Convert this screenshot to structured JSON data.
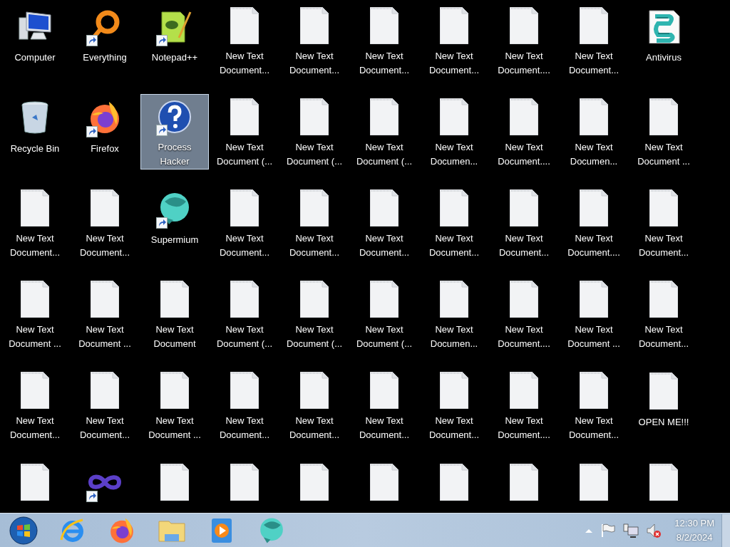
{
  "desktop": {
    "rows": [
      {
        "icons": [
          {
            "kind": "computer",
            "label": "Computer",
            "shortcut": false,
            "selected": false
          },
          {
            "kind": "search-ring",
            "label": "Everything",
            "shortcut": true,
            "selected": false
          },
          {
            "kind": "notepad",
            "label": "Notepad++",
            "shortcut": true,
            "selected": false
          },
          {
            "kind": "textfile",
            "label": "New Text Document...",
            "shortcut": false,
            "selected": false
          },
          {
            "kind": "textfile",
            "label": "New Text Document...",
            "shortcut": false,
            "selected": false
          },
          {
            "kind": "textfile",
            "label": "New Text Document...",
            "shortcut": false,
            "selected": false
          },
          {
            "kind": "textfile",
            "label": "New Text Document...",
            "shortcut": false,
            "selected": false
          },
          {
            "kind": "textfile",
            "label": "New Text Document....",
            "shortcut": false,
            "selected": false
          },
          {
            "kind": "textfile",
            "label": "New Text Document...",
            "shortcut": false,
            "selected": false
          },
          {
            "kind": "script",
            "label": "Antivirus",
            "shortcut": false,
            "selected": false
          }
        ]
      },
      {
        "icons": [
          {
            "kind": "recycle",
            "label": "Recycle Bin",
            "shortcut": false,
            "selected": false
          },
          {
            "kind": "firefox",
            "label": "Firefox",
            "shortcut": true,
            "selected": false
          },
          {
            "kind": "question",
            "label": "Process Hacker",
            "shortcut": true,
            "selected": true
          },
          {
            "kind": "textfile",
            "label": "New Text Document (...",
            "shortcut": false,
            "selected": false
          },
          {
            "kind": "textfile",
            "label": "New Text Document (...",
            "shortcut": false,
            "selected": false
          },
          {
            "kind": "textfile",
            "label": "New Text Document (...",
            "shortcut": false,
            "selected": false
          },
          {
            "kind": "textfile",
            "label": "New Text Documen...",
            "shortcut": false,
            "selected": false
          },
          {
            "kind": "textfile",
            "label": "New Text Document....",
            "shortcut": false,
            "selected": false
          },
          {
            "kind": "textfile",
            "label": "New Text Documen...",
            "shortcut": false,
            "selected": false
          },
          {
            "kind": "textfile",
            "label": "New Text Document ...",
            "shortcut": false,
            "selected": false
          }
        ]
      },
      {
        "icons": [
          {
            "kind": "textfile",
            "label": "New Text Document...",
            "shortcut": false,
            "selected": false
          },
          {
            "kind": "textfile",
            "label": "New Text Document...",
            "shortcut": false,
            "selected": false
          },
          {
            "kind": "sphere",
            "label": "Supermium",
            "shortcut": true,
            "selected": false
          },
          {
            "kind": "textfile",
            "label": "New Text Document...",
            "shortcut": false,
            "selected": false
          },
          {
            "kind": "textfile",
            "label": "New Text Document...",
            "shortcut": false,
            "selected": false
          },
          {
            "kind": "textfile",
            "label": "New Text Document...",
            "shortcut": false,
            "selected": false
          },
          {
            "kind": "textfile",
            "label": "New Text Document...",
            "shortcut": false,
            "selected": false
          },
          {
            "kind": "textfile",
            "label": "New Text Document...",
            "shortcut": false,
            "selected": false
          },
          {
            "kind": "textfile",
            "label": "New Text Document....",
            "shortcut": false,
            "selected": false
          },
          {
            "kind": "textfile",
            "label": "New Text Document...",
            "shortcut": false,
            "selected": false
          }
        ]
      },
      {
        "icons": [
          {
            "kind": "textfile",
            "label": "New Text Document ...",
            "shortcut": false,
            "selected": false
          },
          {
            "kind": "textfile",
            "label": "New Text Document ...",
            "shortcut": false,
            "selected": false
          },
          {
            "kind": "textfile",
            "label": "New Text Document",
            "shortcut": false,
            "selected": false
          },
          {
            "kind": "textfile",
            "label": "New Text Document (...",
            "shortcut": false,
            "selected": false
          },
          {
            "kind": "textfile",
            "label": "New Text Document (...",
            "shortcut": false,
            "selected": false
          },
          {
            "kind": "textfile",
            "label": "New Text Document (...",
            "shortcut": false,
            "selected": false
          },
          {
            "kind": "textfile",
            "label": "New Text Documen...",
            "shortcut": false,
            "selected": false
          },
          {
            "kind": "textfile",
            "label": "New Text Document....",
            "shortcut": false,
            "selected": false
          },
          {
            "kind": "textfile",
            "label": "New Text Document ...",
            "shortcut": false,
            "selected": false
          },
          {
            "kind": "textfile",
            "label": "New Text Document...",
            "shortcut": false,
            "selected": false
          }
        ]
      },
      {
        "icons": [
          {
            "kind": "textfile",
            "label": "New Text Document...",
            "shortcut": false,
            "selected": false
          },
          {
            "kind": "textfile",
            "label": "New Text Document...",
            "shortcut": false,
            "selected": false
          },
          {
            "kind": "textfile",
            "label": "New Text Document ...",
            "shortcut": false,
            "selected": false
          },
          {
            "kind": "textfile",
            "label": "New Text Document...",
            "shortcut": false,
            "selected": false
          },
          {
            "kind": "textfile",
            "label": "New Text Document...",
            "shortcut": false,
            "selected": false
          },
          {
            "kind": "textfile",
            "label": "New Text Document...",
            "shortcut": false,
            "selected": false
          },
          {
            "kind": "textfile",
            "label": "New Text Document...",
            "shortcut": false,
            "selected": false
          },
          {
            "kind": "textfile",
            "label": "New Text Document....",
            "shortcut": false,
            "selected": false
          },
          {
            "kind": "textfile",
            "label": "New Text Document...",
            "shortcut": false,
            "selected": false
          },
          {
            "kind": "textfile",
            "label": "OPEN ME!!!",
            "shortcut": false,
            "selected": false
          }
        ]
      },
      {
        "icons": [
          {
            "kind": "textfile",
            "shortcut": false,
            "selected": false
          },
          {
            "kind": "infinity",
            "shortcut": true,
            "selected": false
          },
          {
            "kind": "textfile",
            "shortcut": false,
            "selected": false
          },
          {
            "kind": "textfile",
            "shortcut": false,
            "selected": false
          },
          {
            "kind": "textfile",
            "shortcut": false,
            "selected": false
          },
          {
            "kind": "textfile",
            "shortcut": false,
            "selected": false
          },
          {
            "kind": "textfile",
            "shortcut": false,
            "selected": false
          },
          {
            "kind": "textfile",
            "shortcut": false,
            "selected": false
          },
          {
            "kind": "textfile",
            "shortcut": false,
            "selected": false
          },
          {
            "kind": "textfile",
            "shortcut": false,
            "selected": false
          }
        ]
      }
    ]
  },
  "taskbar": {
    "pinned": [
      {
        "kind": "start"
      },
      {
        "kind": "ie"
      },
      {
        "kind": "firefox"
      },
      {
        "kind": "folder"
      },
      {
        "kind": "media"
      },
      {
        "kind": "sphere"
      }
    ],
    "tray": {
      "icons": [
        {
          "kind": "up"
        },
        {
          "kind": "flag"
        },
        {
          "kind": "network"
        },
        {
          "kind": "volume-muted"
        }
      ],
      "time": "12:30 PM",
      "date": "8/2/2024"
    }
  }
}
